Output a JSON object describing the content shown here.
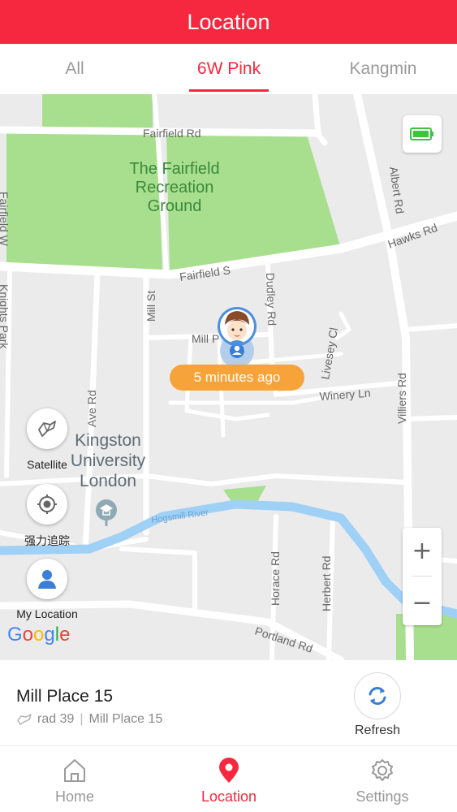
{
  "header": {
    "title": "Location"
  },
  "tabs": [
    {
      "label": "All",
      "active": false
    },
    {
      "label": "6W Pink",
      "active": true
    },
    {
      "label": "Kangmin",
      "active": false
    }
  ],
  "map": {
    "labels": {
      "fairfield_rd": "Fairfield Rd",
      "park_name": [
        "The Fairfield",
        "Recreation",
        "Ground"
      ],
      "fairfield_s": "Fairfield S",
      "albert_rd": "Albert Rd",
      "hawks_rd": "Hawks Rd",
      "fairfield_w": "Fairfield W",
      "knights_park": "Knights Park",
      "mill_st": "Mill St",
      "mill_p": "Mill P",
      "dudley_rd": "Dudley Rd",
      "livesey_cl": "Livesey Cl",
      "winery_ln": "Winery Ln",
      "villiers_rd": "Villiers Rd",
      "ave_rd": "Ave Rd",
      "kingston_univ": [
        "Kingston",
        "University",
        "London"
      ],
      "hogsmill_river": "Hogsmill River",
      "horace_rd": "Horace Rd",
      "herbert_rd": "Herbert Rd",
      "portland_rd": "Portland Rd"
    },
    "marker_time": "5 minutes ago",
    "battery_color": "#3cc43c",
    "controls": {
      "satellite_label": "Satellite",
      "tracking_label": "强力追踪",
      "my_location_label": "My Location",
      "zoom_in": "+",
      "zoom_out": "−"
    },
    "google_logo": [
      "G",
      "o",
      "o",
      "g",
      "l",
      "e"
    ]
  },
  "info": {
    "title": "Mill Place 15",
    "sub_left": "rad 39",
    "sub_right": "Mill Place 15",
    "refresh_label": "Refresh"
  },
  "bottom_nav": [
    {
      "label": "Home",
      "icon": "home-icon",
      "active": false
    },
    {
      "label": "Location",
      "icon": "location-pin-icon",
      "active": true
    },
    {
      "label": "Settings",
      "icon": "gear-icon",
      "active": false
    }
  ],
  "colors": {
    "accent": "#f5283f",
    "badge": "#f6a33a",
    "park": "#a8df8e",
    "river": "#9fd0f5",
    "refresh": "#3a7fd5"
  }
}
